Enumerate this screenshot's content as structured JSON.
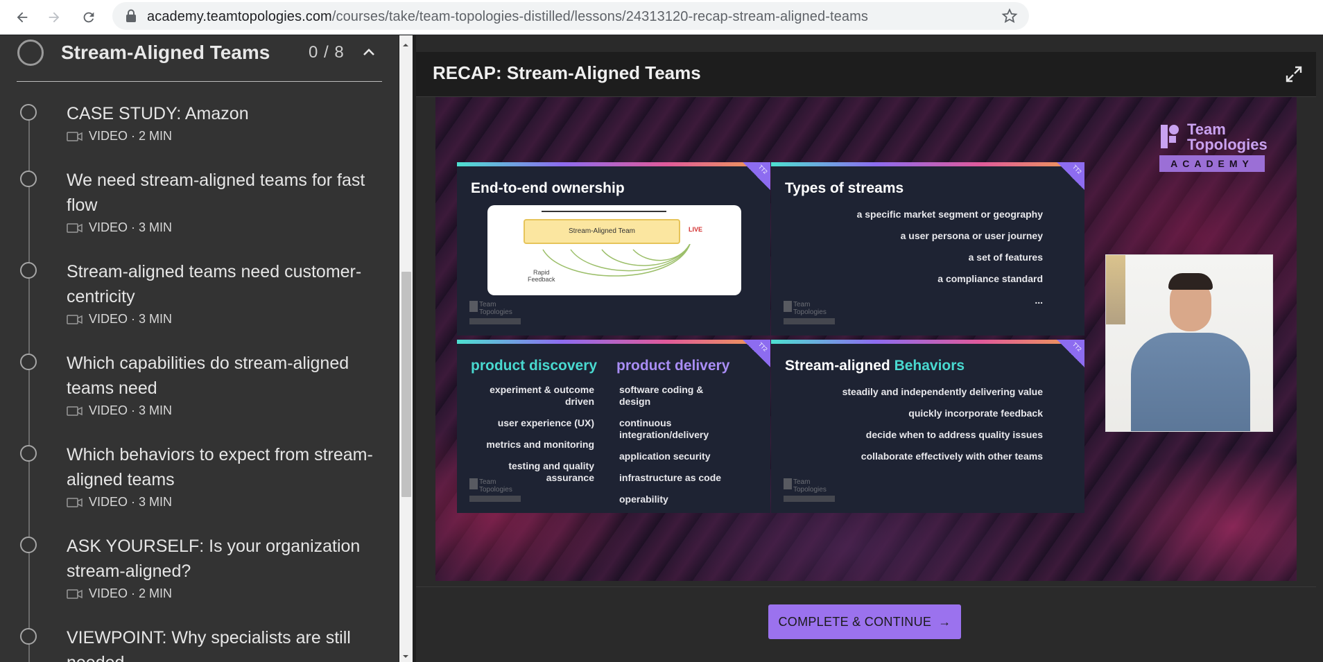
{
  "browser": {
    "url_host": "academy.teamtopologies.com",
    "url_path": "/courses/take/team-topologies-distilled/lessons/24313120-recap-stream-aligned-teams"
  },
  "sidebar": {
    "section_title": "Stream-Aligned Teams",
    "section_count": "0 / 8",
    "lessons": [
      {
        "title": "CASE STUDY: Amazon",
        "meta": "VIDEO · 2 MIN"
      },
      {
        "title": "We need stream-aligned teams for fast flow",
        "meta": "VIDEO · 3 MIN"
      },
      {
        "title": "Stream-aligned teams need customer-centricity",
        "meta": "VIDEO · 3 MIN"
      },
      {
        "title": "Which capabilities do stream-aligned teams need",
        "meta": "VIDEO · 3 MIN"
      },
      {
        "title": "Which behaviors to expect from stream-aligned teams",
        "meta": "VIDEO · 3 MIN"
      },
      {
        "title": "ASK YOURSELF: Is your organization stream-aligned?",
        "meta": "VIDEO · 2 MIN"
      },
      {
        "title": "VIEWPOINT: Why specialists are still needed",
        "meta": ""
      }
    ]
  },
  "main": {
    "title": "RECAP: Stream-Aligned Teams",
    "cta_label": "COMPLETE & CONTINUE",
    "cta_arrow": "→"
  },
  "video": {
    "brand": {
      "name_line1": "Team",
      "name_line2": "Topologies",
      "academy": "ACADEMY"
    },
    "mini_logo": {
      "line1": "Team",
      "line2": "Topologies"
    },
    "corner_tag": "TT2",
    "panel1": {
      "title": "End-to-end ownership",
      "diagram_box": "Stream-Aligned Team",
      "diagram_live": "LIVE",
      "diagram_rapid": "Rapid\nFeedback"
    },
    "panel2": {
      "title": "Types of streams",
      "items": [
        "a specific market segment or geography",
        "a user persona or user journey",
        "a set of features",
        "a compliance standard",
        "..."
      ]
    },
    "panel3": {
      "title_left": "product discovery",
      "title_right": "product delivery",
      "left_items": [
        "experiment & outcome driven",
        "user experience (UX)",
        "metrics and monitoring",
        "testing and quality assurance"
      ],
      "right_items": [
        "software coding & design",
        "continuous integration/delivery",
        "application security",
        "infrastructure as code",
        "operability"
      ]
    },
    "panel4": {
      "title_plain": "Stream-aligned",
      "title_accent": "Behaviors",
      "items": [
        "steadily and independently delivering value",
        "quickly incorporate feedback",
        "decide when to address quality issues",
        "collaborate effectively with other teams"
      ]
    }
  },
  "colors": {
    "accent": "#9b72ee",
    "teal": "#49d9d0",
    "purple": "#a98df5"
  },
  "icons": [
    "back-arrow-icon",
    "forward-arrow-icon",
    "reload-icon",
    "lock-icon",
    "star-icon",
    "chevron-up-icon",
    "video-camera-icon",
    "expand-icon",
    "arrow-right-icon"
  ]
}
